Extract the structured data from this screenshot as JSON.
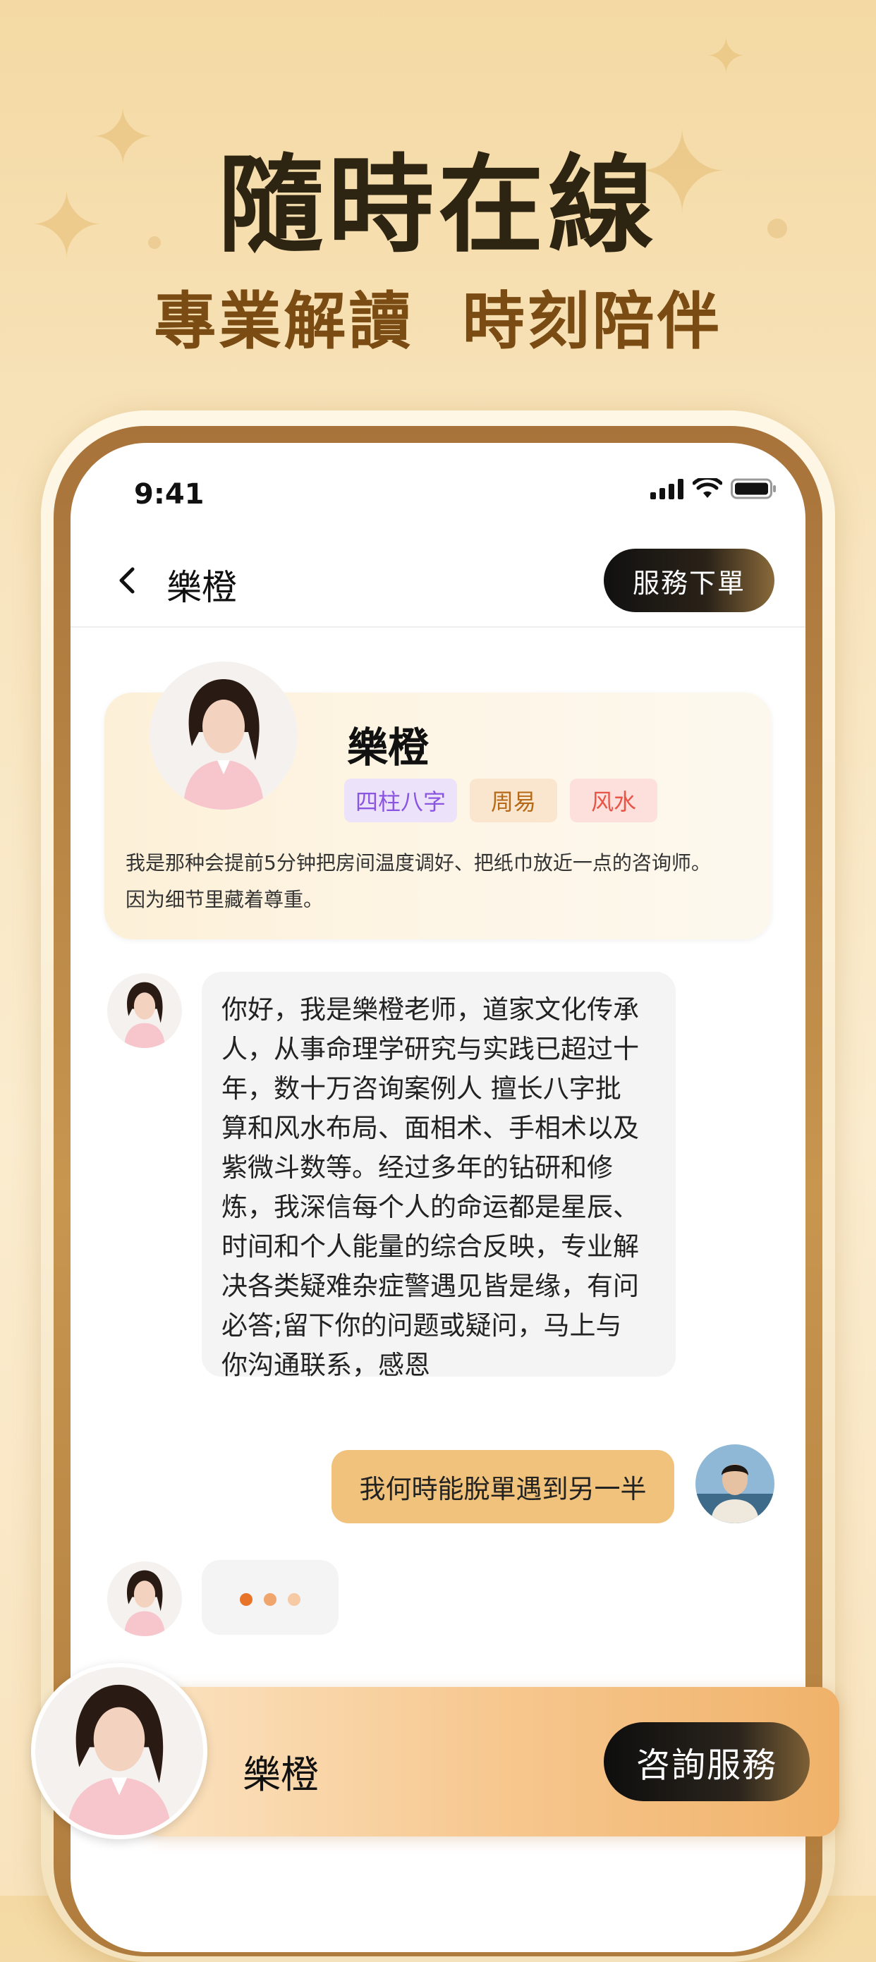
{
  "hero": {
    "title": "隨時在線",
    "subtitle": "專業解讀  時刻陪伴"
  },
  "status_bar": {
    "time": "9:41",
    "icons": [
      "signal-icon",
      "wifi-icon",
      "battery-icon"
    ]
  },
  "nav": {
    "back_icon": "chevron-left-icon",
    "title": "樂橙",
    "order_button": "服務下單"
  },
  "profile": {
    "name": "樂橙",
    "tags": [
      "四柱八字",
      "周易",
      "风水"
    ],
    "bio_lines": [
      "我是那种会提前5分钟把房间温度调好、把纸巾放近一点的咨询师。",
      "因为细节里藏着尊重。"
    ]
  },
  "chat": {
    "advisor_message_lines": [
      "你好，我是樂橙老师，道家文化传承",
      "人，从事命理学研究与实践已超过十",
      "年，数十万咨询案例人 擅长八字批",
      "算和风水布局、面相术、手相术以及",
      "紫微斗数等。经过多年的钻研和修",
      "炼，我深信每个人的命运都是星辰、",
      "时间和个人能量的综合反映，专业解",
      "决各类疑难杂症警遇见皆是缘，有问",
      "必答;留下你的问题或疑问，马上与",
      "你沟通联系，感恩"
    ],
    "user_message": "我何時能脫單遇到另一半",
    "typing_indicator": "..."
  },
  "bottom_bar": {
    "name": "樂橙",
    "consult_button": "咨詢服務"
  },
  "colors": {
    "background": "#f8e5bf",
    "hero_title": "#2e2412",
    "hero_subtitle": "#7a4b12",
    "user_bubble": "#f0c27b",
    "tag_purple": "#8a55e0",
    "tag_orange": "#b66a18",
    "tag_red": "#e85446",
    "typing_dot": "#e8742a"
  }
}
